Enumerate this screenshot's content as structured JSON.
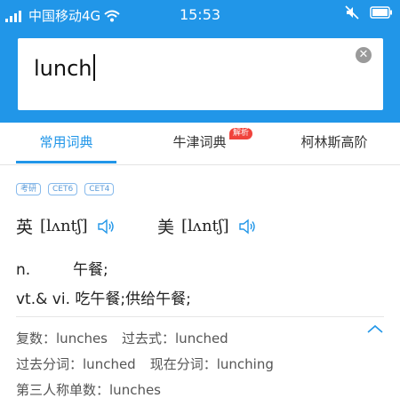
{
  "status_bar": {
    "carrier": "中国移动4G",
    "time": "15:53"
  },
  "search": {
    "query": "lunch",
    "clear_icon": "clear-circle-icon"
  },
  "tabs": [
    {
      "label": "常用词典",
      "active": true
    },
    {
      "label": "牛津词典",
      "active": false,
      "badge": "解析"
    },
    {
      "label": "柯林斯高阶",
      "active": false
    }
  ],
  "tags": [
    "考研",
    "CET6",
    "CET4"
  ],
  "pronunciation": {
    "uk_label": "英",
    "uk_ipa": "[lʌntʃ]",
    "us_label": "美",
    "us_ipa": "[lʌntʃ]"
  },
  "definitions": [
    {
      "pos": "n.",
      "meaning": "午餐;"
    },
    {
      "pos": "vt.& vi.",
      "meaning": "吃午餐;供给午餐;"
    }
  ],
  "word_forms": {
    "plural_label": "复数：",
    "plural": "lunches",
    "past_label": "过去式：",
    "past": "lunched",
    "past_participle_label": "过去分词：",
    "past_participle": "lunched",
    "present_participle_label": "现在分词：",
    "present_participle": "lunching",
    "third_person_label": "第三人称单数：",
    "third_person": "lunches"
  },
  "colors": {
    "accent": "#2196e8",
    "badge": "#f0433c"
  }
}
